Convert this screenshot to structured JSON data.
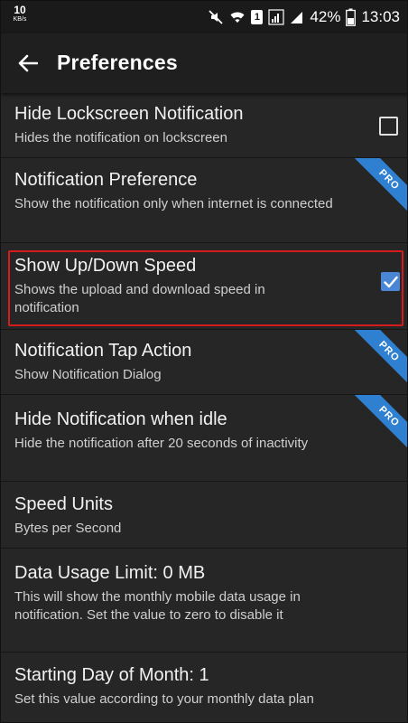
{
  "status_bar": {
    "net_speed": "10",
    "net_speed_unit": "KB/s",
    "sim_badge": "1",
    "battery": "42%",
    "time": "13:03"
  },
  "toolbar": {
    "title": "Preferences"
  },
  "preferences": [
    {
      "title": "Hide Lockscreen Notification",
      "summary": "Hides the notification on lockscreen",
      "checkbox": "unchecked"
    },
    {
      "title": "Notification Preference",
      "summary": "Show the notification only when internet is connected",
      "badge": "PRO"
    },
    {
      "title": "Show Up/Down Speed",
      "summary": "Shows the upload and download speed in notification",
      "checkbox": "checked"
    },
    {
      "title": "Notification Tap Action",
      "summary": "Show Notification Dialog",
      "badge": "PRO"
    },
    {
      "title": "Hide Notification when idle",
      "summary": "Hide the notification after 20 seconds of inactivity",
      "badge": "PRO"
    },
    {
      "title": "Speed Units",
      "summary": "Bytes per Second"
    },
    {
      "title": "Data Usage Limit: 0 MB",
      "summary": "This will show the monthly mobile data usage in notification. Set the value to zero to disable it"
    },
    {
      "title": "Starting Day of Month: 1",
      "summary": "Set this value according to your monthly data plan"
    }
  ],
  "colors": {
    "background": "#262626",
    "toolbar": "#1f1f1f",
    "accent_checkbox": "#4a86d6",
    "pro_ribbon": "#2f80d0",
    "highlight_border": "#d41c1c"
  }
}
